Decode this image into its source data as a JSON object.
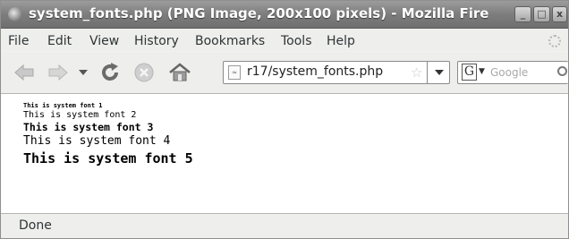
{
  "window": {
    "title": "system_fonts.php (PNG Image, 200x100 pixels) - Mozilla Fire",
    "controls": {
      "minimize": "_",
      "maximize": "□",
      "close": "x"
    }
  },
  "menubar": {
    "items": [
      "File",
      "Edit",
      "View",
      "History",
      "Bookmarks",
      "Tools",
      "Help"
    ]
  },
  "toolbar": {
    "back_icon": "back-arrow-icon",
    "forward_icon": "forward-arrow-icon",
    "history_dropdown_icon": "chevron-down-icon",
    "reload_icon": "reload-icon",
    "stop_icon": "stop-icon",
    "home_icon": "home-icon",
    "url": "r17/system_fonts.php",
    "search_engine_letter": "G",
    "search_placeholder": "Google"
  },
  "content": {
    "lines": [
      "This is system font 1",
      "This is system font 2",
      "This is system font 3",
      "This is system font 4",
      "This is system font 5"
    ]
  },
  "statusbar": {
    "text": "Done"
  },
  "colors": {
    "titlebar": "#7d7d7d",
    "chrome": "#eeeeec",
    "content_bg": "#ffffff"
  }
}
